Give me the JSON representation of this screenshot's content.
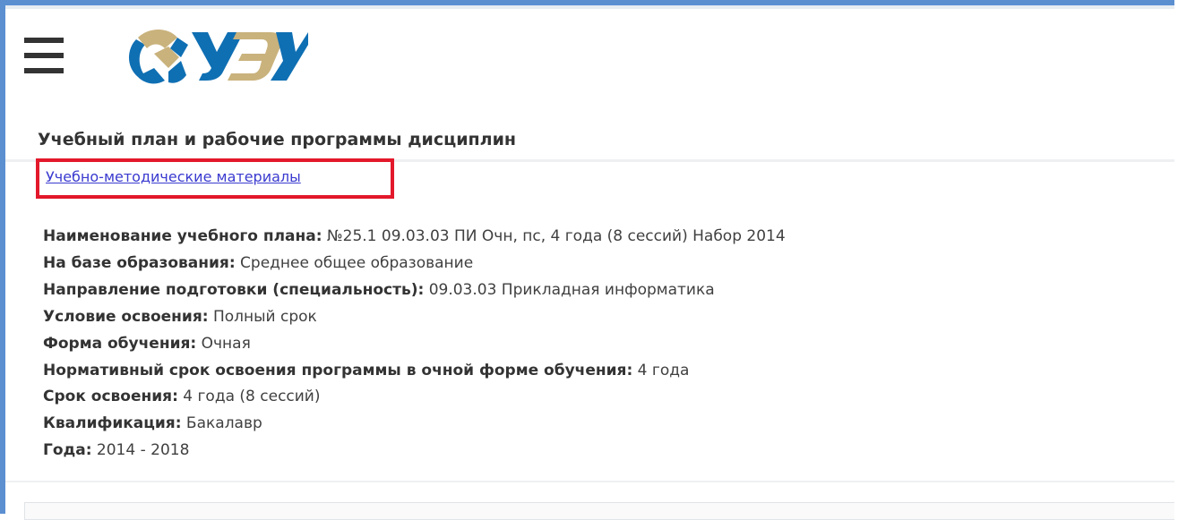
{
  "header": {
    "menu_icon": "hamburger-menu-icon",
    "logo_icon": "university-logo-icon",
    "logo_colors": {
      "blue": "#0f6fb3",
      "gold": "#c9b27c"
    }
  },
  "page": {
    "title": "Учебный план и рабочие программы дисциплин",
    "materials_link": "Учебно-методические материалы",
    "highlight_color": "#e3182b"
  },
  "details": [
    {
      "label": "Наименование учебного плана:",
      "value": "№25.1 09.03.03 ПИ Очн, пс, 4 года (8 сессий) Набор 2014"
    },
    {
      "label": "На базе образования:",
      "value": "Среднее общее образование"
    },
    {
      "label": "Направление подготовки (специальность):",
      "value": "09.03.03 Прикладная информатика"
    },
    {
      "label": "Условие освоения:",
      "value": "Полный срок"
    },
    {
      "label": "Форма обучения:",
      "value": "Очная"
    },
    {
      "label": "Нормативный срок освоения программы в очной форме обучения:",
      "value": "4 года"
    },
    {
      "label": "Срок освоения:",
      "value": "4 года (8 сессий)"
    },
    {
      "label": "Квалификация:",
      "value": "Бакалавр"
    },
    {
      "label": "Года:",
      "value": "2014 - 2018"
    }
  ]
}
